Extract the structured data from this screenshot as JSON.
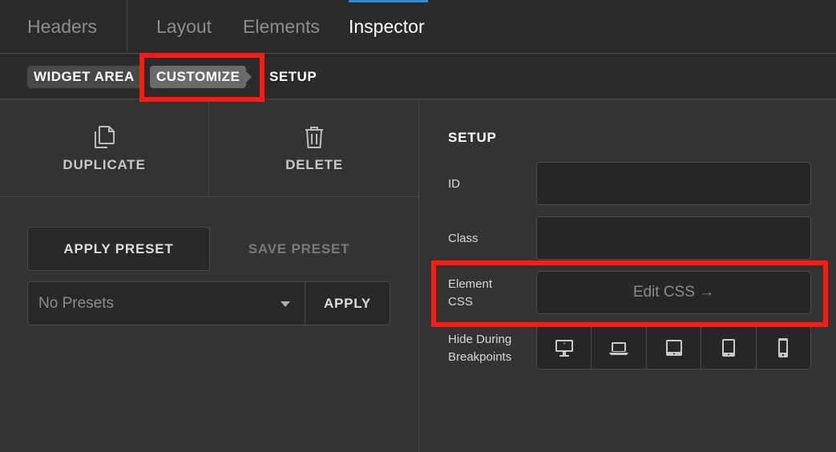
{
  "tabs": {
    "headers": "Headers",
    "layout": "Layout",
    "elements": "Elements",
    "inspector": "Inspector"
  },
  "breadcrumb": {
    "widget_area": "WIDGET AREA",
    "customize": "CUSTOMIZE",
    "setup": "SETUP"
  },
  "actions": {
    "duplicate": "DUPLICATE",
    "delete": "DELETE"
  },
  "presets": {
    "apply_preset": "APPLY PRESET",
    "save_preset": "SAVE PRESET",
    "select_value": "No Presets",
    "apply": "APPLY"
  },
  "setup": {
    "title": "SETUP",
    "id_label": "ID",
    "id_value": "",
    "class_label": "Class",
    "class_value": "",
    "element_css_label_line1": "Element",
    "element_css_label_line2": "CSS",
    "edit_css": "Edit CSS →",
    "hide_label_line1": "Hide During",
    "hide_label_line2": "Breakpoints",
    "breakpoints": [
      "desktop-icon",
      "laptop-icon",
      "tablet-landscape-icon",
      "tablet-portrait-icon",
      "phone-icon"
    ]
  },
  "colors": {
    "accent": "#2e8fd6",
    "highlight": "#ff1a10"
  }
}
